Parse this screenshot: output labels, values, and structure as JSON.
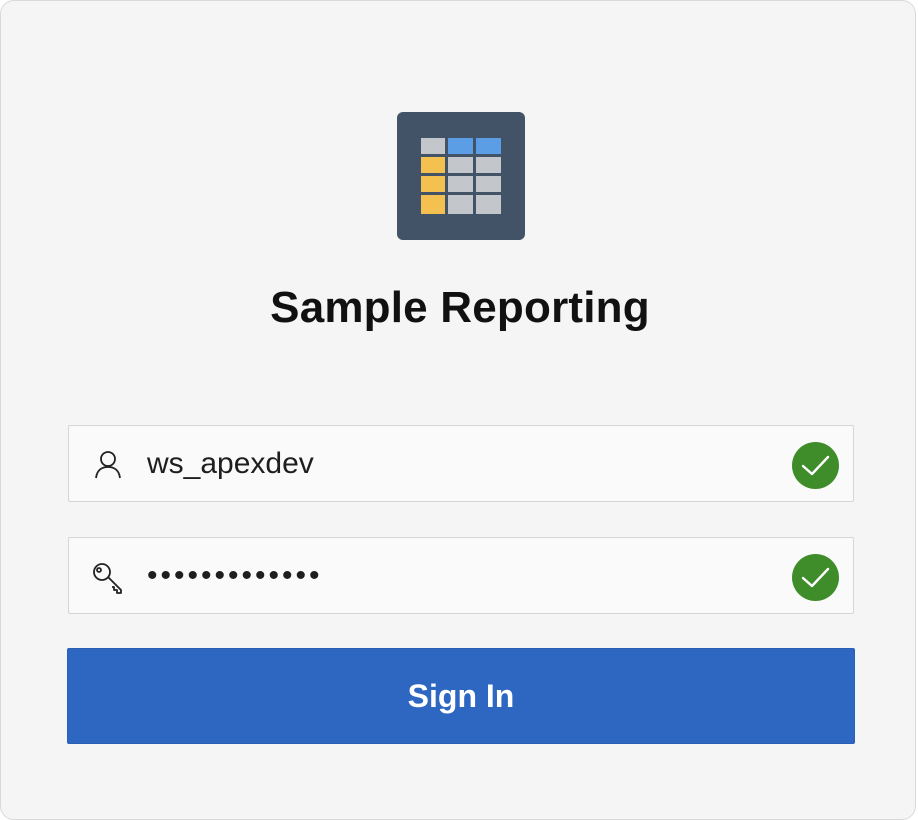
{
  "app": {
    "title": "Sample Reporting",
    "icon": "spreadsheet-grid-icon"
  },
  "login": {
    "username": {
      "value": "ws_apexdev",
      "icon": "user-icon",
      "status": "valid"
    },
    "password": {
      "value": "•••••••••••••",
      "icon": "key-icon",
      "status": "valid"
    },
    "sign_in_label": "Sign In"
  },
  "colors": {
    "background": "#f5f5f5",
    "icon_bg": "#425368",
    "accent_blue": "#2d67c2",
    "valid_green": "#3e8d2a",
    "grid_yellow": "#f4c04f",
    "grid_blue": "#5b9ee6",
    "grid_gray": "#c3c7cb"
  }
}
